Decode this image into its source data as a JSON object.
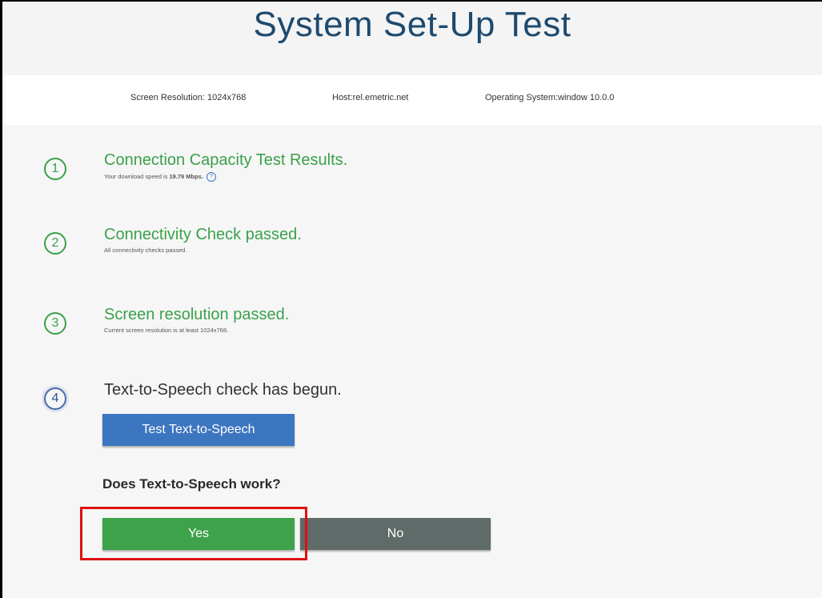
{
  "title": "System Set-Up Test",
  "info": {
    "resolution": "Screen Resolution: 1024x768",
    "host": "Host:rel.emetric.net",
    "os": "Operating System:window 10.0.0"
  },
  "steps": [
    {
      "number": "1",
      "title": "Connection Capacity Test Results.",
      "subtitle_prefix": "Your download speed is ",
      "subtitle_value": "19.79 Mbps.",
      "help": "?"
    },
    {
      "number": "2",
      "title": "Connectivity Check passed.",
      "subtitle": "All connectivity checks passed."
    },
    {
      "number": "3",
      "title": "Screen resolution passed.",
      "subtitle": "Current screen resolution is at least 1024x768."
    },
    {
      "number": "4",
      "title": "Text-to-Speech check has begun."
    }
  ],
  "tts_button": "Test Text-to-Speech",
  "question": "Does Text-to-Speech work?",
  "yes_button": "Yes",
  "no_button": "No",
  "colors": {
    "title": "#1e4a6e",
    "pass_green": "#3aa14a",
    "primary_blue": "#3d76c0",
    "no_gray": "#5f6b68",
    "highlight_red": "#e01010"
  }
}
